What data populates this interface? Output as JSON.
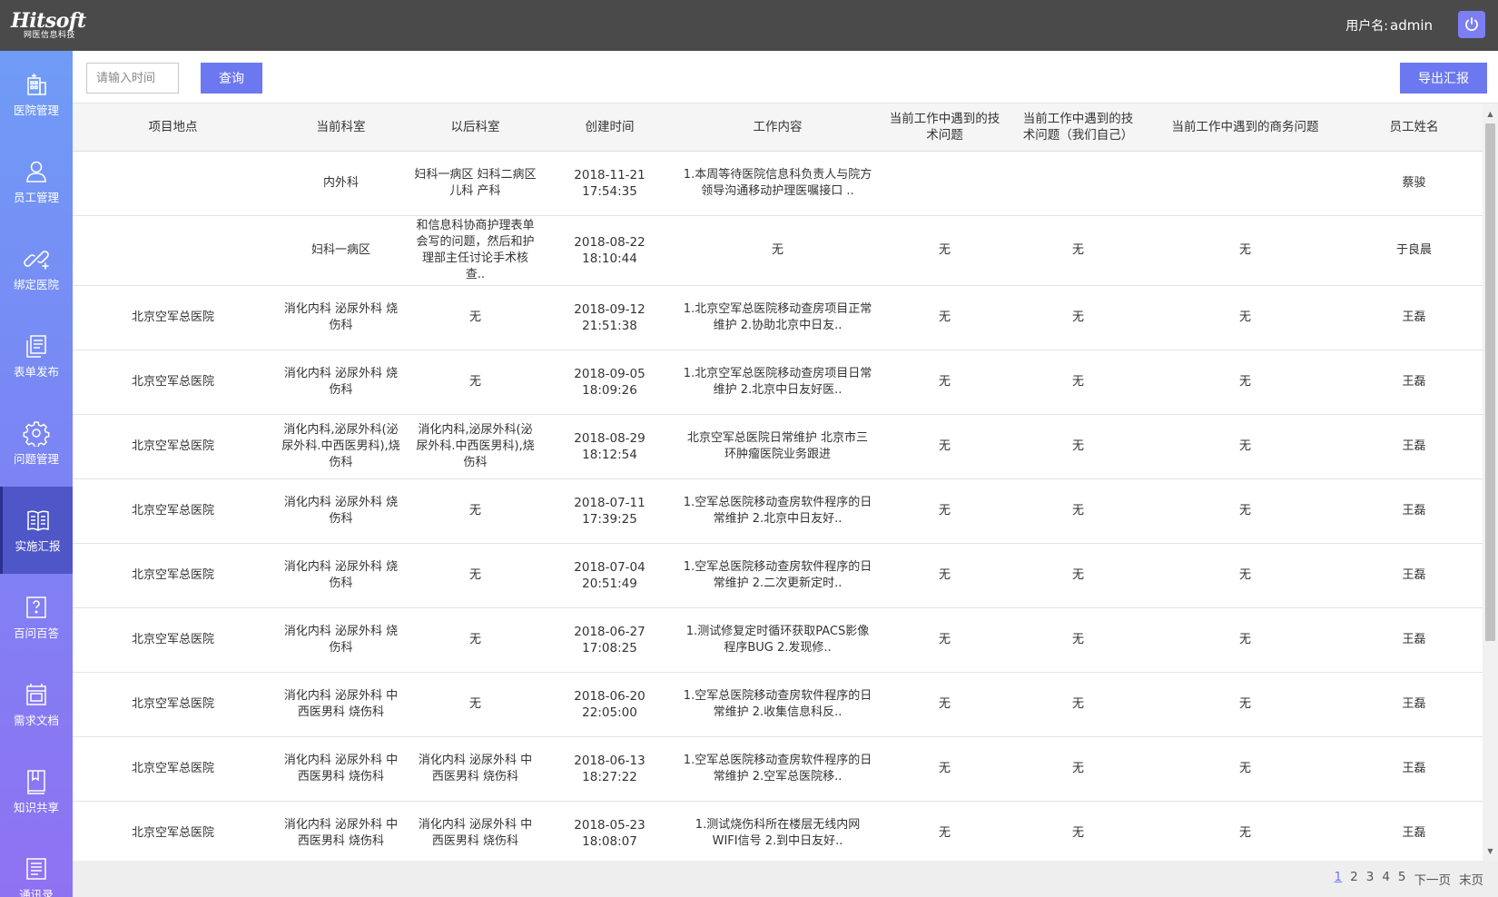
{
  "header": {
    "logo_text": "Hitsoft",
    "logo_sub": "网医信息科技",
    "user_label": "用户名:",
    "username": "admin"
  },
  "sidebar": {
    "items": [
      {
        "label": "医院管理",
        "icon": "hospital-icon"
      },
      {
        "label": "员工管理",
        "icon": "person-icon"
      },
      {
        "label": "绑定医院",
        "icon": "link-icon"
      },
      {
        "label": "表单发布",
        "icon": "form-icon"
      },
      {
        "label": "问题管理",
        "icon": "gear-icon"
      },
      {
        "label": "实施汇报",
        "icon": "book-icon",
        "active": true
      },
      {
        "label": "百问百答",
        "icon": "question-icon"
      },
      {
        "label": "需求文档",
        "icon": "document-icon"
      },
      {
        "label": "知识共享",
        "icon": "knowledge-icon"
      },
      {
        "label": "通讯录",
        "icon": "contacts-icon"
      }
    ]
  },
  "toolbar": {
    "time_placeholder": "请输入时间",
    "query_label": "查询",
    "export_label": "导出汇报"
  },
  "table": {
    "columns": [
      "项目地点",
      "当前科室",
      "以后科室",
      "创建时间",
      "工作内容",
      "当前工作中遇到的技术问题",
      "当前工作中遇到的技术问题（我们自己）",
      "当前工作中遇到的商务问题",
      "员工姓名"
    ],
    "rows": [
      [
        "",
        "内外科",
        "妇科一病区 妇科二病区 儿科 产科",
        "2018-11-21 17:54:35",
        "1.本周等待医院信息科负责人与院方领导沟通移动护理医嘱接口 ..",
        "",
        "",
        "",
        "蔡骏"
      ],
      [
        "",
        "妇科一病区",
        "和信息科协商护理表单会写的问题，然后和护理部主任讨论手术核查..",
        "2018-08-22 18:10:44",
        "无",
        "无",
        "无",
        "无",
        "于良晨"
      ],
      [
        "北京空军总医院",
        "消化内科 泌尿外科 烧伤科",
        "无",
        "2018-09-12 21:51:38",
        "1.北京空军总医院移动查房项目正常维护 2.协助北京中日友..",
        "无",
        "无",
        "无",
        "王磊"
      ],
      [
        "北京空军总医院",
        "消化内科 泌尿外科 烧伤科",
        "无",
        "2018-09-05 18:09:26",
        "1.北京空军总医院移动查房项目日常维护 2.北京中日友好医..",
        "无",
        "无",
        "无",
        "王磊"
      ],
      [
        "北京空军总医院",
        "消化内科,泌尿外科(泌尿外科.中西医男科),烧伤科",
        "消化内科,泌尿外科(泌尿外科.中西医男科),烧伤科",
        "2018-08-29 18:12:54",
        "北京空军总医院日常维护 北京市三环肿瘤医院业务跟进",
        "无",
        "无",
        "无",
        "王磊"
      ],
      [
        "北京空军总医院",
        "消化内科 泌尿外科 烧伤科",
        "无",
        "2018-07-11 17:39:25",
        "1.空军总医院移动查房软件程序的日常维护 2.北京中日友好..",
        "无",
        "无",
        "无",
        "王磊"
      ],
      [
        "北京空军总医院",
        "消化内科 泌尿外科 烧伤科",
        "无",
        "2018-07-04 20:51:49",
        "1.空军总医院移动查房软件程序的日常维护 2.二次更新定时..",
        "无",
        "无",
        "无",
        "王磊"
      ],
      [
        "北京空军总医院",
        "消化内科 泌尿外科 烧伤科",
        "无",
        "2018-06-27 17:08:25",
        "1.测试修复定时循环获取PACS影像程序BUG 2.发现修..",
        "无",
        "无",
        "无",
        "王磊"
      ],
      [
        "北京空军总医院",
        "消化内科 泌尿外科 中西医男科 烧伤科",
        "无",
        "2018-06-20 22:05:00",
        "1.空军总医院移动查房软件程序的日常维护 2.收集信息科反..",
        "无",
        "无",
        "无",
        "王磊"
      ],
      [
        "北京空军总医院",
        "消化内科 泌尿外科 中西医男科 烧伤科",
        "消化内科 泌尿外科 中西医男科 烧伤科",
        "2018-06-13 18:27:22",
        "1.空军总医院移动查房软件程序的日常维护 2.空军总医院移..",
        "无",
        "无",
        "无",
        "王磊"
      ],
      [
        "北京空军总医院",
        "消化内科 泌尿外科 中西医男科 烧伤科",
        "消化内科 泌尿外科 中西医男科 烧伤科",
        "2018-05-23 18:08:07",
        "1.测试烧伤科所在楼层无线内网WIFI信号 2.到中日友好..",
        "无",
        "无",
        "无",
        "王磊"
      ]
    ]
  },
  "pagination": {
    "pages": [
      "1",
      "2",
      "3",
      "4",
      "5"
    ],
    "current": "1",
    "next_label": "下一页",
    "last_label": "末页"
  },
  "colors": {
    "accent": "#6c78f0",
    "header_bg": "#4a4a4a",
    "sidebar_active": "#4e56c8"
  }
}
